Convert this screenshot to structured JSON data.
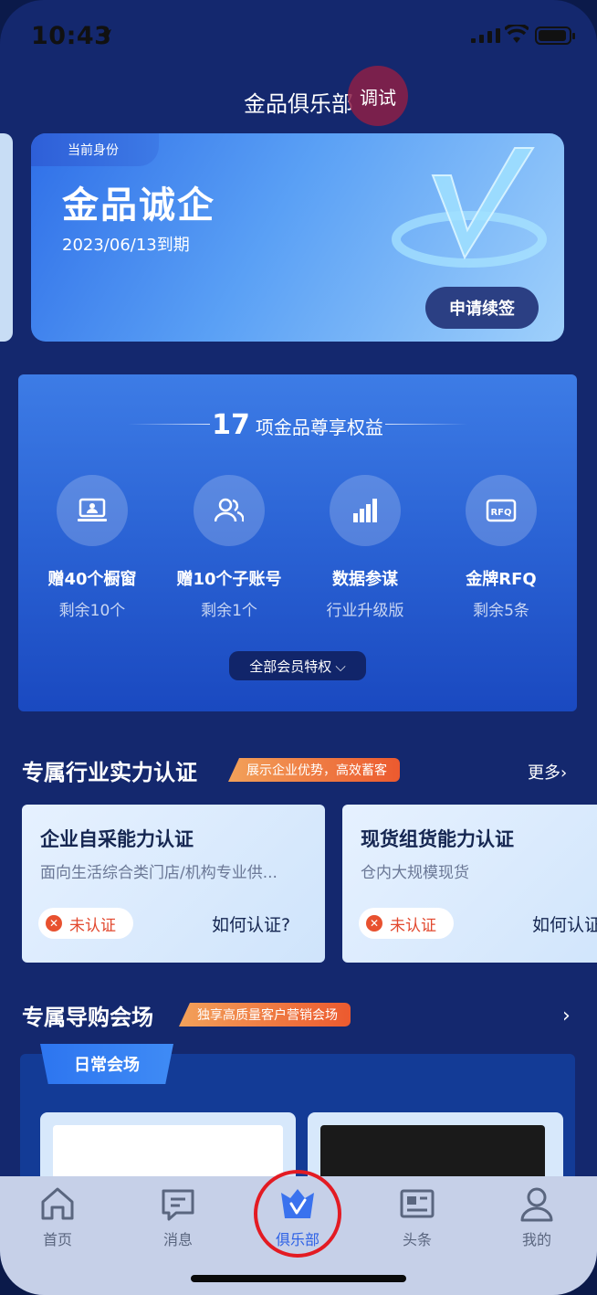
{
  "status_bar": {
    "time": "10:43"
  },
  "header": {
    "title": "金品俱乐部",
    "debug_badge": "调试"
  },
  "member_card": {
    "identity_label": "当前身份",
    "level": "金品诚企",
    "expiry": "2023/06/13到期",
    "renew_button": "申请续签"
  },
  "benefits": {
    "count": "17",
    "title_suffix": "项金品尊享权益",
    "items": [
      {
        "name": "赠40个橱窗",
        "sub": "剩余10个",
        "icon": "showcase-icon"
      },
      {
        "name": "赠10个子账号",
        "sub": "剩余1个",
        "icon": "sub-accounts-icon"
      },
      {
        "name": "数据参谋",
        "sub": "行业升级版",
        "icon": "bar-chart-icon"
      },
      {
        "name": "金牌RFQ",
        "sub": "剩余5条",
        "icon": "rfq-icon"
      }
    ],
    "all_button": "全部会员特权 ⌵"
  },
  "certification": {
    "title": "专属行业实力认证",
    "tag": "展示企业优势，高效蓄客",
    "more": "更多›",
    "cards": [
      {
        "title": "企业自采能力认证",
        "desc": "面向生活综合类门店/机构专业供...",
        "status": "未认证",
        "how": "如何认证?"
      },
      {
        "title": "现货组货能力认证",
        "desc": "仓内大规模现货",
        "status": "未认证",
        "how": "如何认证?"
      }
    ]
  },
  "venue": {
    "title": "专属导购会场",
    "tag": "独享高质量客户营销会场",
    "arrow": "›",
    "tab": "日常会场"
  },
  "tabbar": {
    "items": [
      {
        "label": "首页",
        "icon": "home-icon"
      },
      {
        "label": "消息",
        "icon": "message-icon"
      },
      {
        "label": "俱乐部",
        "icon": "club-crown-icon"
      },
      {
        "label": "头条",
        "icon": "news-icon"
      },
      {
        "label": "我的",
        "icon": "profile-icon"
      }
    ]
  },
  "colors": {
    "background": "#14286e",
    "accent": "#2e62e6",
    "tag_orange": "#ec5a2f",
    "highlight_ring": "#e31b23"
  }
}
